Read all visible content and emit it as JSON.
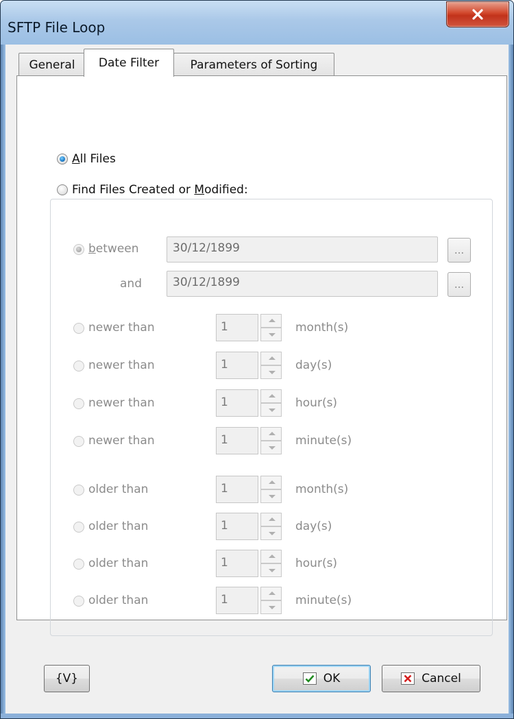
{
  "window": {
    "title": "SFTP File Loop",
    "close_icon": "close-icon"
  },
  "tabs": [
    {
      "label": "General",
      "active": false
    },
    {
      "label": "Date Filter",
      "active": true
    },
    {
      "label": "Parameters of Sorting",
      "active": false
    }
  ],
  "mode": {
    "all_files": {
      "prefix": "A",
      "rest": "ll Files",
      "checked": true
    },
    "find_files": {
      "before": "Find Files Created or ",
      "mnemonic": "M",
      "after": "odified:",
      "checked": false
    }
  },
  "between": {
    "radio_prefix": "b",
    "radio_rest": "etween",
    "and_label": "and",
    "from": "30/12/1899",
    "to": "30/12/1899",
    "browse_label": "..."
  },
  "newer": [
    {
      "label": "newer than",
      "value": "1",
      "unit": "month(s)"
    },
    {
      "label": "newer than",
      "value": "1",
      "unit": "day(s)"
    },
    {
      "label": "newer than",
      "value": "1",
      "unit": "hour(s)"
    },
    {
      "label": "newer than",
      "value": "1",
      "unit": "minute(s)"
    }
  ],
  "older": [
    {
      "label": "older than",
      "value": "1",
      "unit": "month(s)"
    },
    {
      "label": "older than",
      "value": "1",
      "unit": "day(s)"
    },
    {
      "label": "older than",
      "value": "1",
      "unit": "hour(s)"
    },
    {
      "label": "older than",
      "value": "1",
      "unit": "minute(s)"
    }
  ],
  "buttons": {
    "variables": "{V}",
    "ok": "OK",
    "cancel": "Cancel"
  },
  "colors": {
    "ok_check": "#1f8a1f",
    "cancel_x": "#d41e1e",
    "radio_checked": "#1f7ec9"
  }
}
